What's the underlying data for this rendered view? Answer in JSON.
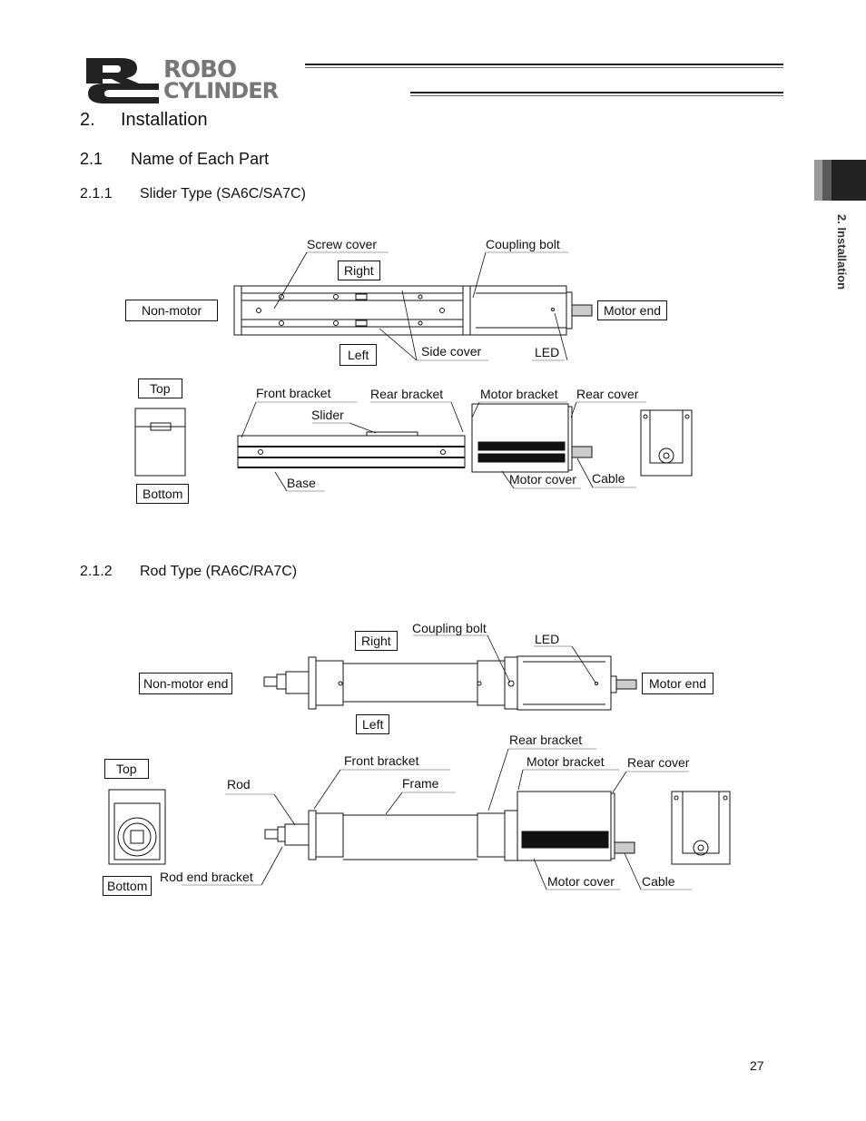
{
  "header": {
    "logo_line1": "ROBO",
    "logo_line2": "CYLINDER",
    "logo_mark": "RC"
  },
  "side_tab": {
    "label": "2. Installation",
    "colors": [
      "#999999",
      "#5a5a5a",
      "#222222"
    ]
  },
  "headings": {
    "h1_num": "2.",
    "h1_text": "Installation",
    "h2_num": "2.1",
    "h2_text": "Name of Each Part",
    "h3a_num": "2.1.1",
    "h3a_text": "Slider Type (SA6C/SA7C)",
    "h3b_num": "2.1.2",
    "h3b_text": "Rod Type (RA6C/RA7C)"
  },
  "slider_diagram": {
    "boxes": {
      "right": "Right",
      "left": "Left",
      "non_motor": "Non-motor",
      "motor_end": "Motor end",
      "top": "Top",
      "bottom": "Bottom"
    },
    "labels": {
      "screw_cover": "Screw cover",
      "coupling_bolt": "Coupling bolt",
      "side_cover": "Side cover",
      "led": "LED",
      "front_bracket": "Front bracket",
      "rear_bracket": "Rear bracket",
      "motor_bracket": "Motor bracket",
      "rear_cover": "Rear cover",
      "slider": "Slider",
      "base": "Base",
      "motor_cover": "Motor cover",
      "cable": "Cable"
    }
  },
  "rod_diagram": {
    "boxes": {
      "right": "Right",
      "left": "Left",
      "non_motor_end": "Non-motor end",
      "motor_end": "Motor end",
      "top": "Top",
      "bottom": "Bottom"
    },
    "labels": {
      "coupling_bolt": "Coupling bolt",
      "led": "LED",
      "rear_bracket": "Rear bracket",
      "front_bracket": "Front bracket",
      "motor_bracket": "Motor bracket",
      "rear_cover": "Rear cover",
      "rod": "Rod",
      "frame": "Frame",
      "rod_end_bracket": "Rod end bracket",
      "motor_cover": "Motor cover",
      "cable": "Cable"
    }
  },
  "footer": {
    "page_number": "27"
  }
}
